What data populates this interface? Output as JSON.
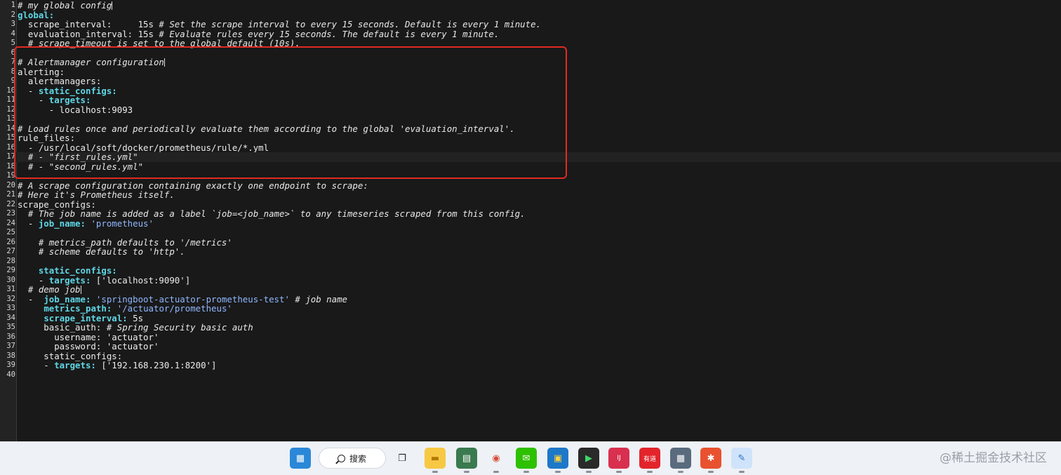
{
  "editor": {
    "lines": [
      {
        "n": "1",
        "parts": [
          {
            "t": "# my global config",
            "c": "c"
          },
          {
            "cursor": true
          }
        ]
      },
      {
        "n": "2",
        "parts": [
          {
            "t": "global:",
            "c": "k"
          }
        ]
      },
      {
        "n": "3",
        "parts": [
          {
            "t": "  scrape_interval:     15s "
          },
          {
            "t": "# Set the scrape interval to every 15 seconds. Default is every 1 minute.",
            "c": "c"
          }
        ]
      },
      {
        "n": "4",
        "parts": [
          {
            "t": "  evaluation_interval: 15s "
          },
          {
            "t": "# Evaluate rules every 15 seconds. The default is every 1 minute.",
            "c": "c"
          }
        ]
      },
      {
        "n": "5",
        "parts": [
          {
            "t": "  # scrape_timeout is set to the global default (10s).",
            "c": "c"
          }
        ]
      },
      {
        "n": "6",
        "parts": []
      },
      {
        "n": "7",
        "parts": [
          {
            "t": "# Alertmanager configuration",
            "c": "c"
          },
          {
            "cursor": true
          }
        ]
      },
      {
        "n": "8",
        "parts": [
          {
            "t": "alerting:"
          }
        ]
      },
      {
        "n": "9",
        "parts": [
          {
            "t": "  alertmanagers:"
          }
        ]
      },
      {
        "n": "10",
        "parts": [
          {
            "t": "  - "
          },
          {
            "t": "static_configs:",
            "c": "k"
          }
        ]
      },
      {
        "n": "11",
        "parts": [
          {
            "t": "    - "
          },
          {
            "t": "targets:",
            "c": "k"
          }
        ]
      },
      {
        "n": "12",
        "parts": [
          {
            "t": "      - localhost:9093"
          }
        ]
      },
      {
        "n": "13",
        "parts": []
      },
      {
        "n": "14",
        "parts": [
          {
            "t": "# Load rules once and periodically evaluate them according to the global 'evaluation_interval'.",
            "c": "c"
          }
        ]
      },
      {
        "n": "15",
        "parts": [
          {
            "t": "rule_files:"
          }
        ]
      },
      {
        "n": "16",
        "parts": [
          {
            "t": "  - /usr/local/soft/docker/prometheus/rule/*.yml"
          }
        ]
      },
      {
        "n": "17",
        "parts": [
          {
            "t": "  # - \"first_rules.yml\"",
            "c": "c"
          }
        ],
        "current": true
      },
      {
        "n": "18",
        "parts": [
          {
            "t": "  # - \"second_rules.yml\"",
            "c": "c"
          }
        ]
      },
      {
        "n": "19",
        "parts": []
      },
      {
        "n": "20",
        "parts": [
          {
            "t": "# A scrape configuration containing exactly one endpoint to scrape:",
            "c": "c"
          }
        ]
      },
      {
        "n": "21",
        "parts": [
          {
            "t": "# Here it's Prometheus itself.",
            "c": "c"
          }
        ]
      },
      {
        "n": "22",
        "parts": [
          {
            "t": "scrape_configs:"
          }
        ]
      },
      {
        "n": "23",
        "parts": [
          {
            "t": "  # The job name is added as a label `job=<job_name>` to any timeseries scraped from this config.",
            "c": "c"
          }
        ]
      },
      {
        "n": "24",
        "parts": [
          {
            "t": "  - "
          },
          {
            "t": "job_name:",
            "c": "k"
          },
          {
            "t": " "
          },
          {
            "t": "'prometheus'",
            "c": "s"
          }
        ]
      },
      {
        "n": "25",
        "parts": []
      },
      {
        "n": "26",
        "parts": [
          {
            "t": "    # metrics_path defaults to '/metrics'",
            "c": "c"
          }
        ]
      },
      {
        "n": "27",
        "parts": [
          {
            "t": "    # scheme defaults to 'http'.",
            "c": "c"
          }
        ]
      },
      {
        "n": "28",
        "parts": []
      },
      {
        "n": "29",
        "parts": [
          {
            "t": "    "
          },
          {
            "t": "static_configs:",
            "c": "k"
          }
        ]
      },
      {
        "n": "30",
        "parts": [
          {
            "t": "    - "
          },
          {
            "t": "targets:",
            "c": "k"
          },
          {
            "t": " ['localhost:9090']"
          }
        ]
      },
      {
        "n": "31",
        "parts": [
          {
            "t": "  # demo job",
            "c": "c"
          },
          {
            "cursor": true
          }
        ]
      },
      {
        "n": "32",
        "parts": [
          {
            "t": "  -  "
          },
          {
            "t": "job_name:",
            "c": "k"
          },
          {
            "t": " "
          },
          {
            "t": "'springboot-actuator-prometheus-test'",
            "c": "s"
          },
          {
            "t": " "
          },
          {
            "t": "# job name",
            "c": "c"
          }
        ]
      },
      {
        "n": "33",
        "parts": [
          {
            "t": "     "
          },
          {
            "t": "metrics_path:",
            "c": "k"
          },
          {
            "t": " "
          },
          {
            "t": "'/actuator/prometheus'",
            "c": "s"
          }
        ]
      },
      {
        "n": "34",
        "parts": [
          {
            "t": "     "
          },
          {
            "t": "scrape_interval:",
            "c": "k"
          },
          {
            "t": " 5s"
          }
        ]
      },
      {
        "n": "35",
        "parts": [
          {
            "t": "     basic_auth: "
          },
          {
            "t": "# Spring Security basic auth",
            "c": "c"
          }
        ]
      },
      {
        "n": "36",
        "parts": [
          {
            "t": "       username: 'actuator'"
          }
        ]
      },
      {
        "n": "37",
        "parts": [
          {
            "t": "       password: 'actuator'"
          }
        ]
      },
      {
        "n": "38",
        "parts": [
          {
            "t": "     static_configs:"
          }
        ]
      },
      {
        "n": "39",
        "parts": [
          {
            "t": "     - "
          },
          {
            "t": "targets:",
            "c": "k"
          },
          {
            "t": " ['192.168.230.1:8200']"
          }
        ]
      },
      {
        "n": "40",
        "parts": []
      }
    ]
  },
  "taskbar": {
    "search_label": "搜索",
    "watermark": "@稀土掘金技术社区",
    "icons": [
      {
        "name": "windows-start-icon",
        "bg": "#2b88d8",
        "glyph": "▦",
        "color": "#ffffff"
      },
      {
        "name": "task-view-icon",
        "bg": "#eef1f6",
        "glyph": "❐",
        "color": "#222222"
      },
      {
        "name": "file-explorer-icon",
        "bg": "#f7c844",
        "glyph": "▬",
        "color": "#b07a00"
      },
      {
        "name": "document-viewer-icon",
        "bg": "#3a7a4f",
        "glyph": "▤",
        "color": "#ffffff"
      },
      {
        "name": "chrome-icon",
        "bg": "#eef1f6",
        "glyph": "◉",
        "color": "#d84a38"
      },
      {
        "name": "wechat-icon",
        "bg": "#2dc100",
        "glyph": "✉",
        "color": "#ffffff"
      },
      {
        "name": "virtualbox-icon",
        "bg": "#1e78c8",
        "glyph": "▣",
        "color": "#ffd23f"
      },
      {
        "name": "terminal-icon",
        "bg": "#2a2a2a",
        "glyph": "▶",
        "color": "#41d66b"
      },
      {
        "name": "intellij-icon",
        "bg": "#d9304f",
        "glyph": "IJ",
        "color": "#ffffff"
      },
      {
        "name": "youdao-icon",
        "bg": "#e3242b",
        "glyph": "有道",
        "color": "#ffffff"
      },
      {
        "name": "calculator-icon",
        "bg": "#5a6b7d",
        "glyph": "▦",
        "color": "#ffffff"
      },
      {
        "name": "xmind-icon",
        "bg": "#e8522f",
        "glyph": "✱",
        "color": "#ffffff"
      },
      {
        "name": "notepad-icon",
        "bg": "#cfe4fb",
        "glyph": "✎",
        "color": "#2b6fc4"
      }
    ]
  }
}
